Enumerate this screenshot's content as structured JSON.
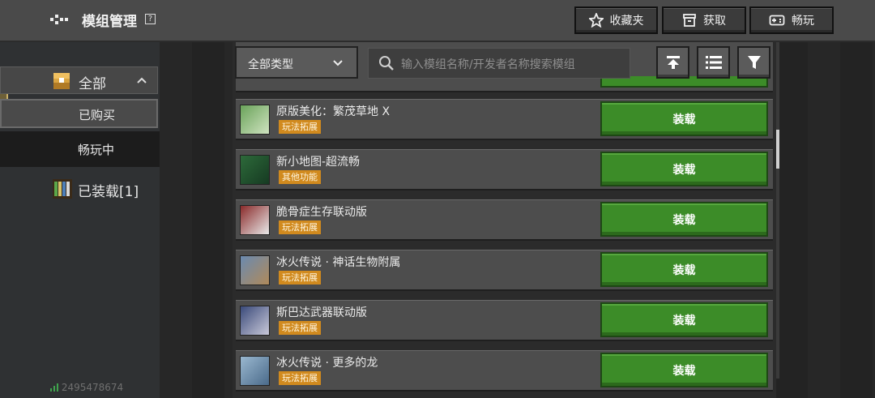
{
  "header": {
    "title": "模组管理",
    "help_label": "?",
    "buttons": [
      {
        "label": "收藏夹",
        "icon": "star-icon"
      },
      {
        "label": "获取",
        "icon": "store-icon"
      },
      {
        "label": "畅玩",
        "icon": "gamepad-icon"
      }
    ]
  },
  "sidebar": {
    "all_label": "全部",
    "sub_items": [
      "已购买",
      "畅玩中"
    ],
    "equipped_label": "已装载[1]",
    "account_id": "2495478674"
  },
  "filter": {
    "type_label": "全部类型",
    "search_placeholder": "输入模组名称/开发者名称搜索模组"
  },
  "mods": [
    {
      "name": "原版美化：繁茂草地 X",
      "tag": "玩法拓展",
      "action": "装载"
    },
    {
      "name": "新小地图-超流畅",
      "tag": "其他功能",
      "action": "装载"
    },
    {
      "name": "脆骨症生存联动版",
      "tag": "玩法拓展",
      "action": "装载"
    },
    {
      "name": "冰火传说 · 神话生物附属",
      "tag": "玩法拓展",
      "action": "装载"
    },
    {
      "name": "斯巴达武器联动版",
      "tag": "玩法拓展",
      "action": "装载"
    },
    {
      "name": "冰火传说 · 更多的龙",
      "tag": "玩法拓展",
      "action": "装载"
    }
  ],
  "colors": {
    "equip_green": "#3c8c28",
    "tag_orange": "#d18a1e",
    "topbar": "#4a4a4a"
  }
}
